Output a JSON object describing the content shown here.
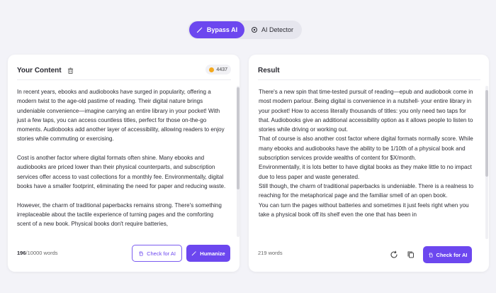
{
  "mode_toggle": {
    "bypass_label": "Bypass AI",
    "detector_label": "AI Detector"
  },
  "input_panel": {
    "title": "Your Content",
    "credits": "4437",
    "paragraphs": [
      "In recent years, ebooks and audiobooks have surged in popularity, offering a modern twist to the age-old pastime of reading. Their digital nature brings undeniable convenience—imagine carrying an entire library in your pocket! With just a few taps, you can access countless titles, perfect for those on-the-go moments. Audiobooks add another layer of accessibility, allowing readers to enjoy stories while commuting or exercising.",
      "Cost is another factor where digital formats often shine. Many ebooks and audiobooks are priced lower than their physical counterparts, and subscription services offer access to vast collections for a monthly fee. Environmentally, digital books have a smaller footprint, eliminating the need for paper and reducing waste.",
      "However, the charm of traditional paperbacks remains strong. There's something irreplaceable about the tactile experience of turning pages and the comforting scent of a new book. Physical books don't require batteries,"
    ],
    "word_count_current": "196",
    "word_count_limit": "/10000 words",
    "check_label": "Check for AI",
    "humanize_label": "Humanize"
  },
  "result_panel": {
    "title": "Result",
    "paragraphs": [
      "There's a new spin that time-tested pursuit of reading—epub and audiobook come in most modern parlour. Being digital is convenience in a nutshell- your entire library in your pocket! How to access literally thousands of titles: you only need two taps for that. Audiobooks give an additional accessibility option as it allows people to listen to stories while driving or working out.",
      "That of course is also another cost factor where digital formats normally score. While many ebooks and audiobooks have the ability to be 1/10th of a physical book and subscription services provide wealths of content for $X/month.",
      "Environmentally, it is lots better to have digital books as they make little to no impact due to less paper and waste generated.",
      "Still though, the charm of traditional paperbacks is undeniable. There is a realness to reaching for the metaphorical page and the familiar smell of an open book.",
      "You can turn the pages without batteries and sometimes it just feels right when you take a physical book off its shelf even the one that has been in"
    ],
    "word_count": "219 words",
    "check_label": "Check for AI"
  },
  "colors": {
    "accent": "#6c47ef",
    "background": "#f3f3f8",
    "coin": "#f3a81d"
  }
}
